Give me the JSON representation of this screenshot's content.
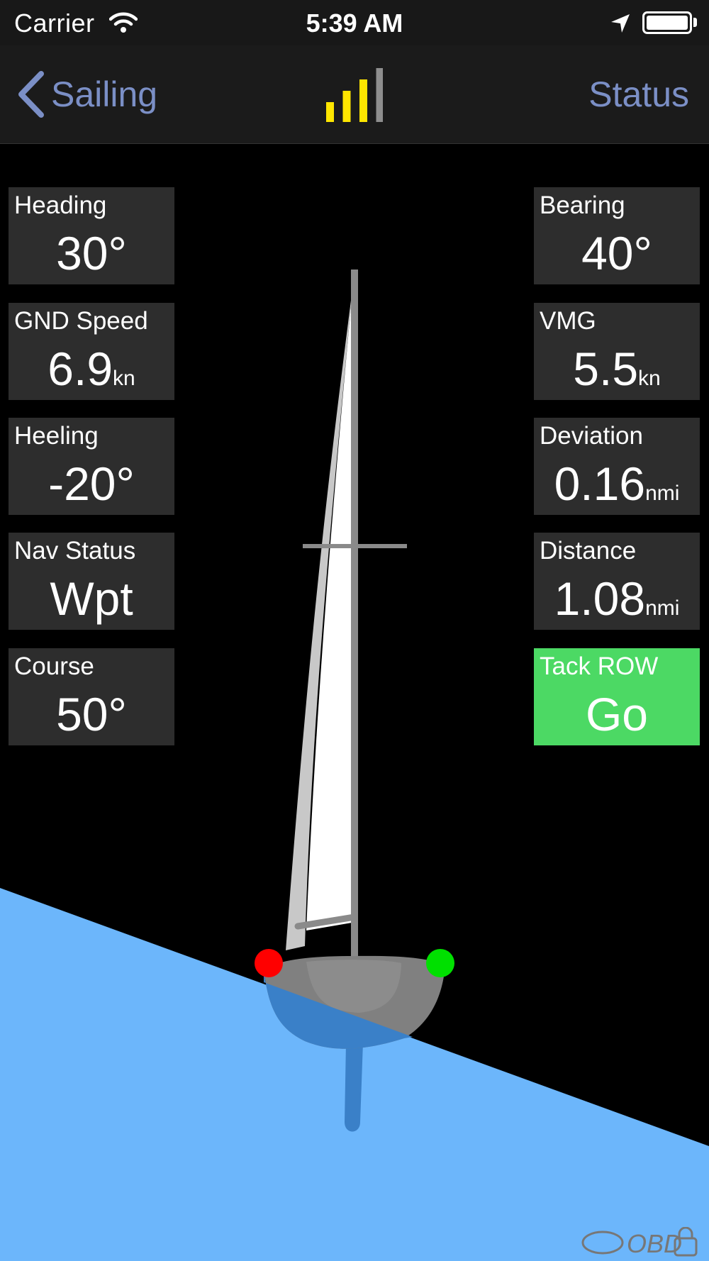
{
  "status_bar": {
    "carrier": "Carrier",
    "time": "5:39 AM"
  },
  "nav": {
    "back_label": "Sailing",
    "right_label": "Status",
    "signal_bars_active": 3,
    "signal_bars_total": 4
  },
  "left_tiles": [
    {
      "label": "Heading",
      "value": "30°",
      "unit": ""
    },
    {
      "label": "GND Speed",
      "value": "6.9",
      "unit": "kn"
    },
    {
      "label": "Heeling",
      "value": "-20°",
      "unit": ""
    },
    {
      "label": "Nav Status",
      "value": "Wpt",
      "unit": ""
    },
    {
      "label": "Course",
      "value": "50°",
      "unit": ""
    }
  ],
  "right_tiles": [
    {
      "label": "Bearing",
      "value": "40°",
      "unit": ""
    },
    {
      "label": "VMG",
      "value": "5.5",
      "unit": "kn"
    },
    {
      "label": "Deviation",
      "value": "0.16",
      "unit": "nmi"
    },
    {
      "label": "Distance",
      "value": "1.08",
      "unit": "nmi"
    },
    {
      "label": "Tack ROW",
      "value": "Go",
      "unit": ""
    }
  ],
  "colors": {
    "accent_link": "#7b8fc6",
    "signal_active": "#ffe600",
    "signal_inactive": "#8e8e8e",
    "tile_bg": "#2d2d2d",
    "go_green": "#4cd964",
    "water": "#6cb6fb",
    "port_light": "#ff0000",
    "starboard_light": "#00e000"
  },
  "watermark": "OBD"
}
